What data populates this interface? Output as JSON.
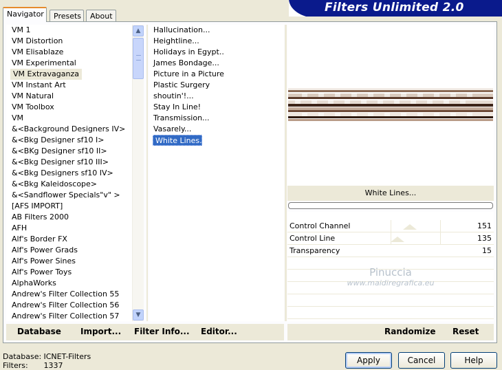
{
  "tabs": [
    "Navigator",
    "Presets",
    "About"
  ],
  "banner_title": "Filters Unlimited 2.0",
  "categories": [
    "VM 1",
    "VM Distortion",
    "VM Elisablaze",
    "VM Experimental",
    "VM Extravaganza",
    "VM Instant Art",
    "VM Natural",
    "VM Toolbox",
    "VM",
    "&<Background Designers IV>",
    "&<Bkg Designer sf10 I>",
    "&<BKg Designer sf10 II>",
    "&<Bkg Designer sf10 III>",
    "&<Bkg Designers sf10 IV>",
    "&<Bkg Kaleidoscope>",
    "&<Sandflower Specials\"v\" >",
    "[AFS IMPORT]",
    "AB Filters 2000",
    "AFH",
    "Alf's Border FX",
    "Alf's Power Grads",
    "Alf's Power Sines",
    "Alf's Power Toys",
    "AlphaWorks",
    "Andrew's Filter Collection 55",
    "Andrew's Filter Collection 56",
    "Andrew's Filter Collection 57"
  ],
  "selected_category": "VM Extravaganza",
  "filters": [
    "Hallucination...",
    "Heightline...",
    "Holidays in Egypt..",
    "James Bondage...",
    "Picture in a Picture",
    "Plastic Surgery",
    "shoutin'!...",
    "Stay In Line!",
    "Transmission...",
    "Vasarely...",
    "White Lines..."
  ],
  "selected_filter": "White Lines...",
  "filter_title": "White Lines...",
  "params": [
    {
      "label": "Control Channel",
      "value": "151"
    },
    {
      "label": "Control Line",
      "value": "135"
    },
    {
      "label": "Transparency",
      "value": "15"
    }
  ],
  "watermark": {
    "line1": "Pinuccia",
    "line2": "www.maidiregrafica.eu"
  },
  "toolbar": {
    "database": "Database",
    "import": "Import...",
    "filter_info": "Filter Info...",
    "editor": "Editor...",
    "randomize": "Randomize",
    "reset": "Reset"
  },
  "status": {
    "database_label": "Database:",
    "database_value": "ICNET-Filters",
    "filters_label": "Filters:",
    "filters_value": "1337"
  },
  "buttons": {
    "apply": "Apply",
    "cancel": "Cancel",
    "help": "Help"
  }
}
